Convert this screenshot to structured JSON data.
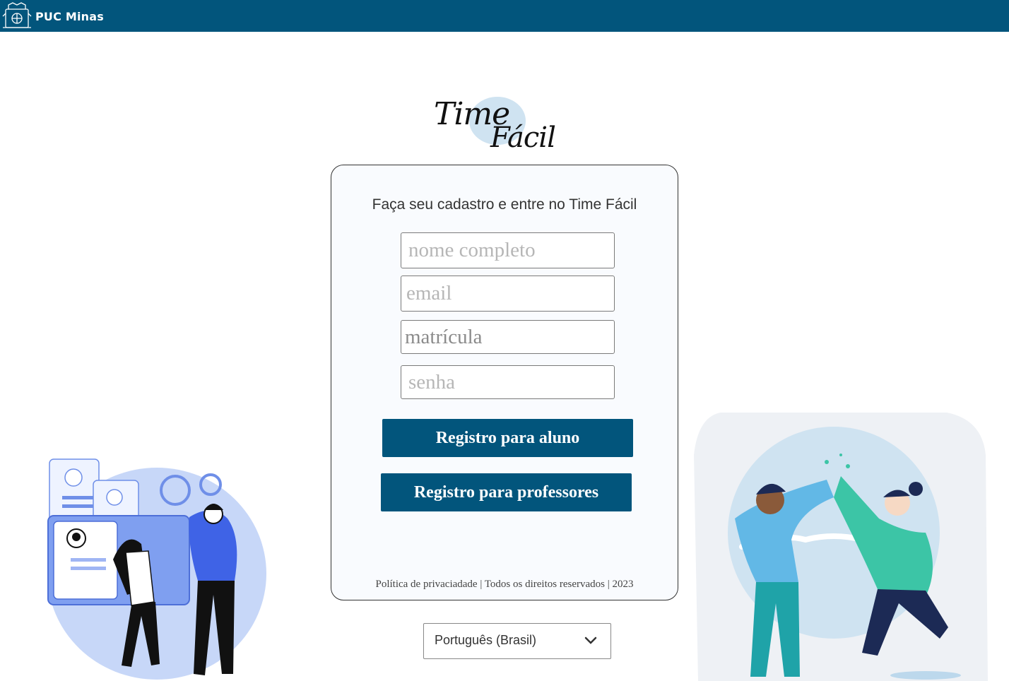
{
  "header": {
    "brand": "PUC Minas",
    "crest_icon": "puc-crest-icon",
    "background": "#02557c"
  },
  "logo": {
    "word1": "Time",
    "word2": "Fácil"
  },
  "form": {
    "title": "Faça seu cadastro e entre no Time Fácil",
    "fields": {
      "name_placeholder": "nome completo",
      "email_placeholder": "email",
      "matricula_placeholder": "matrícula",
      "password_placeholder": "senha"
    },
    "buttons": {
      "student": "Registro para aluno",
      "teacher": "Registro para professores"
    },
    "footer": "Política de privaciadade | Todos os direitos reservados |  2023",
    "accent": "#02557c"
  },
  "language": {
    "selected": "Português (Brasil)",
    "icon": "chevron-down-icon"
  },
  "illustrations": {
    "left": "profile-selection-illustration",
    "right": "high-five-illustration"
  }
}
